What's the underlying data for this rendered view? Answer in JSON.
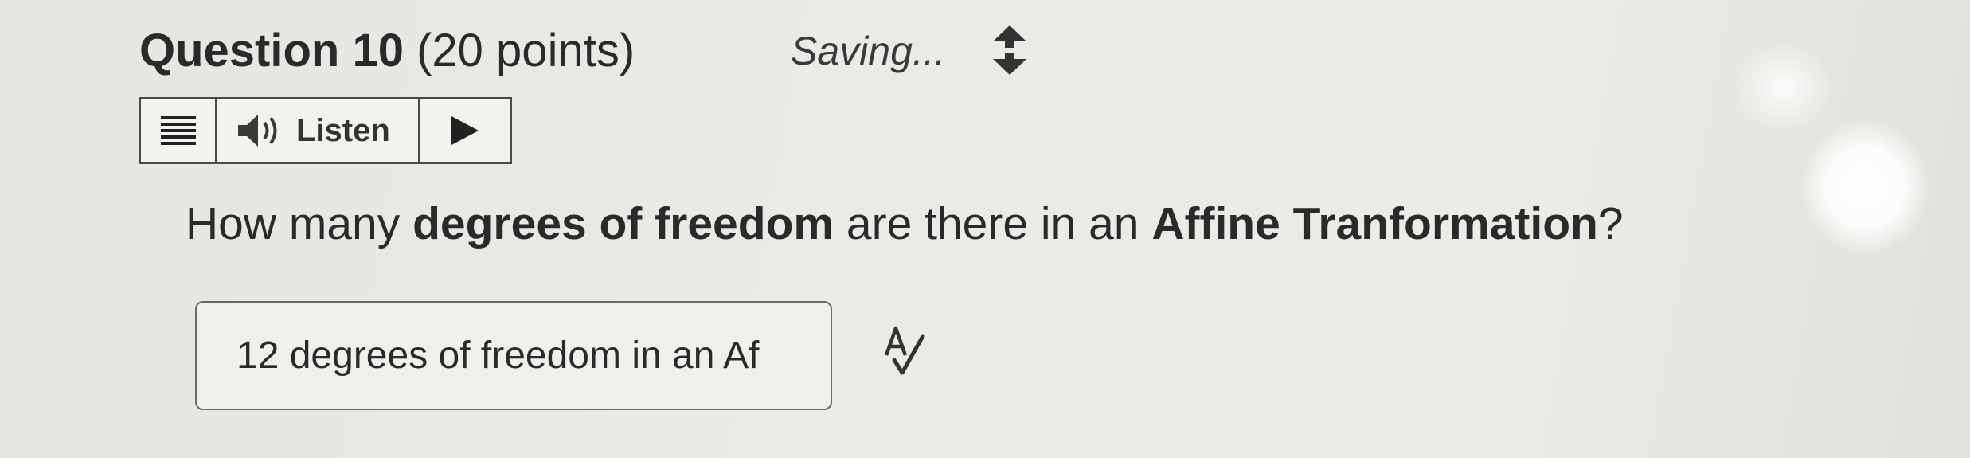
{
  "question": {
    "title_main": "Question 10",
    "title_points": "(20 points)",
    "status": "Saving...",
    "prompt_parts": [
      {
        "text": "How many ",
        "bold": false
      },
      {
        "text": "degrees of freedom",
        "bold": true
      },
      {
        "text": " are there in an ",
        "bold": false
      },
      {
        "text": "Affine Tranformation",
        "bold": true
      },
      {
        "text": "?",
        "bold": false
      }
    ]
  },
  "toolbar": {
    "menu_icon": "menu-icon",
    "speaker_icon": "speaker-icon",
    "listen_label": "Listen",
    "play_icon": "play-icon"
  },
  "answer": {
    "value": "12 degrees of freedom in an Af",
    "spellcheck_icon": "spellcheck-icon"
  },
  "colors": {
    "background": "#ebeae6",
    "text": "#2a2a2a",
    "border": "#4a4a4a",
    "input_border": "#6a6a6a"
  }
}
